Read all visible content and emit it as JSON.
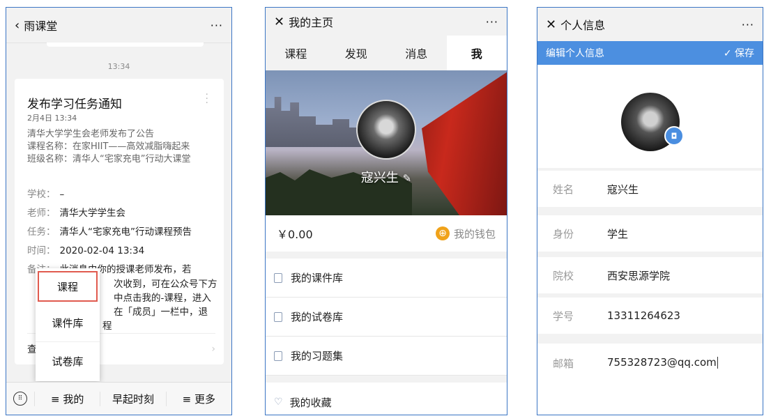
{
  "panel1": {
    "title": "雨课堂",
    "more": "···",
    "timestamp": "13:34",
    "card": {
      "title": "发布学习任务通知",
      "date": "2月4日 13:34",
      "lines": [
        "清华大学学生会老师发布了公告",
        "课程名称：在家HIIT——高效减脂嗨起来",
        "班级名称：清华人“宅家充电”行动大课堂"
      ],
      "fields": [
        {
          "key": "学校：",
          "value": "–"
        },
        {
          "key": "老师：",
          "value": "清华大学学生会"
        },
        {
          "key": "任务：",
          "value": "清华人“宅家充电”行动课程预告"
        },
        {
          "key": "时间：",
          "value": "2020-02-04 13:34"
        }
      ],
      "note_label": "备注：",
      "note_lines": [
        "此消息由你的授课老师发布，若",
        "次收到，可在公众号下方",
        "中点击我的-课程，进入",
        "在「成员」一栏中，退",
        "程"
      ],
      "view_label": "查",
      "view_arrow": "›"
    },
    "popup": [
      "课程",
      "课件库",
      "试卷库"
    ],
    "bottom": [
      "≡ 我的",
      "早起时刻",
      "≡ 更多"
    ]
  },
  "panel2": {
    "title": "我的主页",
    "more": "···",
    "tabs": [
      "课程",
      "发现",
      "消息",
      "我"
    ],
    "username": "寇兴生",
    "edit_glyph": "✎",
    "balance": "￥0.00",
    "wallet_label": "我的钱包",
    "menu": [
      "我的课件库",
      "我的试卷库",
      "我的习题集",
      "我的收藏"
    ]
  },
  "panel3": {
    "title": "个人信息",
    "more": "···",
    "edit_title": "编辑个人信息",
    "save_label": "✓ 保存",
    "fields": [
      {
        "label": "姓名",
        "value": "寇兴生"
      },
      {
        "label": "身份",
        "value": "学生"
      },
      {
        "label": "院校",
        "value": "西安思源学院"
      },
      {
        "label": "学号",
        "value": "13311264623"
      },
      {
        "label": "邮箱",
        "value": "755328723@qq.com"
      }
    ]
  },
  "colors": {
    "accent": "#4c8fe0",
    "wallet": "#f0a219",
    "border": "#3a75c4",
    "highlight": "#e05a4e"
  }
}
